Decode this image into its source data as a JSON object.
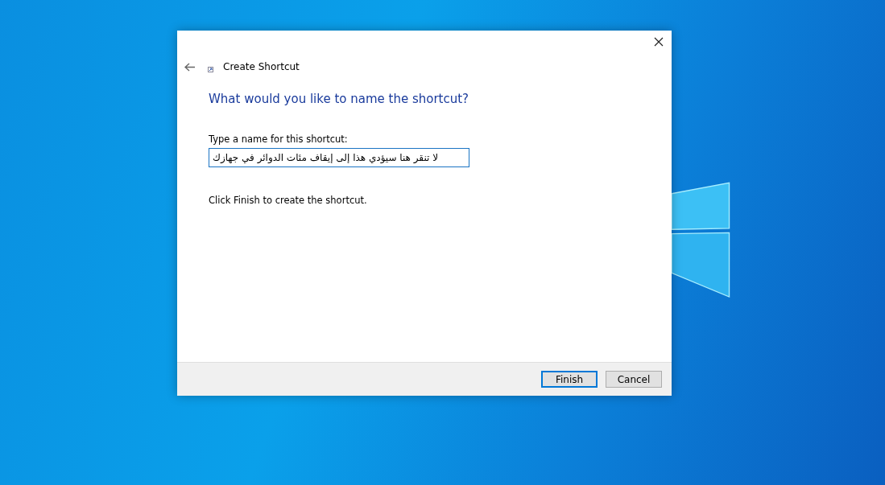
{
  "window": {
    "title": "Create Shortcut"
  },
  "heading": "What would you like to name the shortcut?",
  "name_field": {
    "label": "Type a name for this shortcut:",
    "value": "لا تنقر هنا سيؤدي هذا إلى إيقاف مئات الدوائر في جهازك"
  },
  "hint": "Click Finish to create the shortcut.",
  "buttons": [
    {
      "label": "Finish",
      "kind": "default"
    },
    {
      "label": "Cancel",
      "kind": "normal"
    }
  ]
}
